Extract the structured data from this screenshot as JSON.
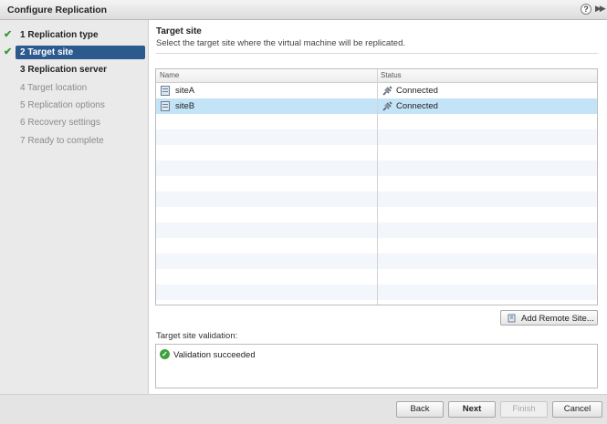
{
  "window": {
    "title": "Configure Replication"
  },
  "steps": [
    {
      "number": "1",
      "label": "Replication type",
      "state": "done"
    },
    {
      "number": "2",
      "label": "Target site",
      "state": "current"
    },
    {
      "number": "3",
      "label": "Replication server",
      "state": "next"
    },
    {
      "number": "4",
      "label": "Target location",
      "state": "future"
    },
    {
      "number": "5",
      "label": "Replication options",
      "state": "future"
    },
    {
      "number": "6",
      "label": "Recovery settings",
      "state": "future"
    },
    {
      "number": "7",
      "label": "Ready to complete",
      "state": "future"
    }
  ],
  "page": {
    "title": "Target site",
    "subtitle": "Select the target site where the virtual machine will be replicated."
  },
  "grid": {
    "columns": [
      "Name",
      "Status"
    ],
    "rows": [
      {
        "name": "siteA",
        "status": "Connected",
        "selected": false
      },
      {
        "name": "siteB",
        "status": "Connected",
        "selected": true
      }
    ]
  },
  "add_site_button": "Add Remote Site...",
  "validation": {
    "label": "Target site validation:",
    "message": "Validation succeeded"
  },
  "footer": {
    "back": "Back",
    "next": "Next",
    "finish": "Finish",
    "cancel": "Cancel"
  },
  "colors": {
    "current_step": "#2d5a8e",
    "selected_row": "#c3e3f7",
    "check": "#3a9a3a"
  }
}
